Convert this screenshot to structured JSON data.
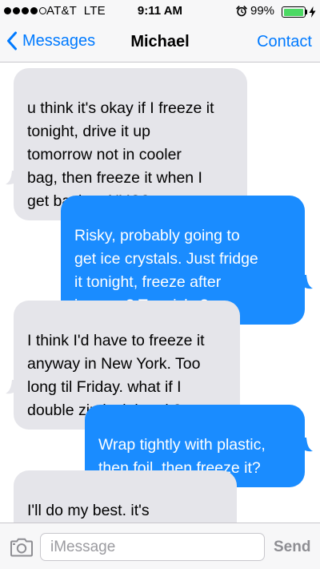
{
  "status_bar": {
    "signal_bars": {
      "filled": 4,
      "total": 5
    },
    "carrier": "AT&T",
    "network": "LTE",
    "time": "9:11 AM",
    "battery_percent": "99%",
    "battery_level": 0.99,
    "icons": [
      "alarm-clock-icon",
      "battery-icon",
      "charging-bolt-icon"
    ]
  },
  "nav": {
    "back_label": "Messages",
    "title": "Michael",
    "contact_label": "Contact",
    "back_icon": "chevron-left-icon"
  },
  "thread": {
    "messages": [
      {
        "direction": "received",
        "text": "u think it's okay if I freeze it\ntonight, drive it up\ntomorrow not in cooler\nbag, then freeze it when I\nget back to NYC?"
      },
      {
        "direction": "sent",
        "text": "Risky, probably going to\nget ice crystals. Just fridge\nit tonight, freeze after\njourney? Too risky?"
      },
      {
        "direction": "received",
        "text": "I think I'd have to freeze it\nanyway in New York. Too\nlong til Friday. what if I\ndouble zip lock bag it?"
      },
      {
        "direction": "sent",
        "text": "Wrap tightly with plastic,\nthen foil, then freeze it?"
      },
      {
        "direction": "received",
        "text": "I'll do my best. it's\nhandicapped but I think\nwe'll still get there"
      }
    ]
  },
  "compose": {
    "placeholder": "iMessage",
    "value": "",
    "send_label": "Send",
    "camera_icon": "camera-icon"
  },
  "colors": {
    "accent": "#007aff",
    "sent_bubble": "#1a8cff",
    "received_bubble": "#e5e5ea",
    "battery_fill": "#4cd964",
    "bar_background": "#f7f7f8",
    "send_disabled": "#8e8e93"
  }
}
